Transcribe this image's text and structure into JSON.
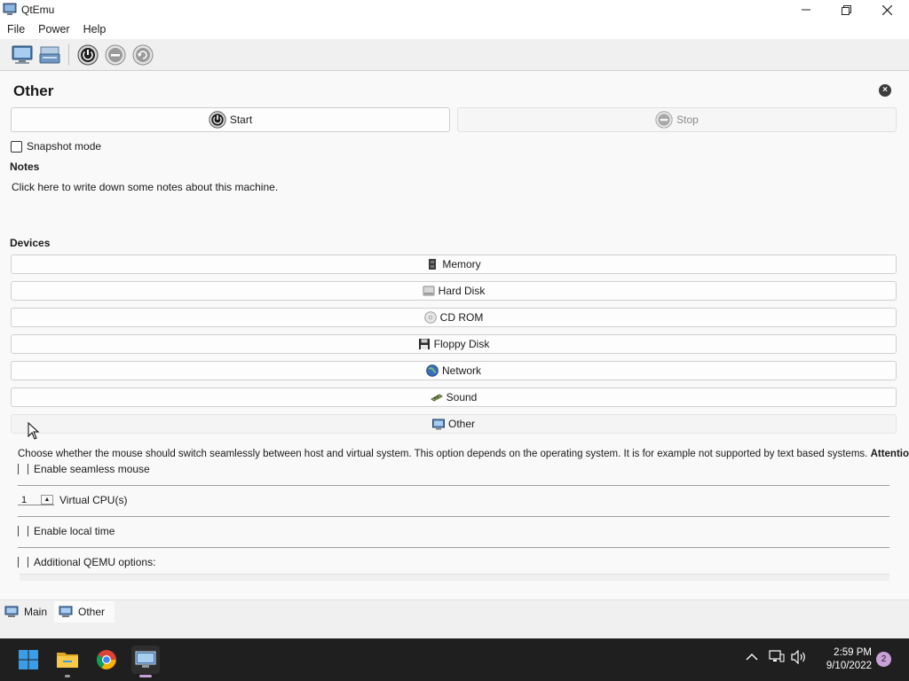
{
  "window": {
    "title": "QtEmu"
  },
  "menu": [
    "File",
    "Power",
    "Help"
  ],
  "toolbar": {
    "buttons": [
      "new-machine-icon",
      "open-machine-icon",
      "power-on-icon",
      "pause-icon",
      "reset-icon"
    ]
  },
  "page": {
    "title": "Other",
    "start_label": "Start",
    "stop_label": "Stop",
    "snapshot_label": "Snapshot mode",
    "notes_heading": "Notes",
    "notes_text": "Click here to write down some notes about this machine.",
    "devices_heading": "Devices"
  },
  "devices": [
    {
      "label": "Memory",
      "icon": "memory-icon"
    },
    {
      "label": "Hard Disk",
      "icon": "hard-disk-icon"
    },
    {
      "label": "CD ROM",
      "icon": "cd-rom-icon"
    },
    {
      "label": "Floppy Disk",
      "icon": "floppy-disk-icon"
    },
    {
      "label": "Network",
      "icon": "network-icon"
    },
    {
      "label": "Sound",
      "icon": "sound-icon"
    },
    {
      "label": "Other",
      "icon": "other-icon"
    }
  ],
  "other_panel": {
    "description": "Choose whether the mouse should switch seamlessly between host and virtual system. This option depends on the operating system. It is for example not supported by text based systems.",
    "attention": "Attention:",
    "seamless_mouse": "Enable seamless mouse",
    "cpu_value": "1",
    "cpu_label": "Virtual CPU(s)",
    "local_time": "Enable local time",
    "qemu_options": "Additional QEMU options:"
  },
  "tabs": [
    {
      "label": "Main",
      "selected": false
    },
    {
      "label": "Other",
      "selected": true
    }
  ],
  "taskbar": {
    "time": "2:59 PM",
    "date": "9/10/2022",
    "notifications": "2",
    "apps": [
      "windows-start-icon",
      "file-explorer-icon",
      "chrome-icon",
      "qtemu-icon"
    ]
  },
  "colors": {
    "taskbar_bg": "#1f1f1f",
    "start_blue": "#3b9de8",
    "folder_yellow": "#f7c948",
    "notif_badge": "#c9a0d8"
  }
}
